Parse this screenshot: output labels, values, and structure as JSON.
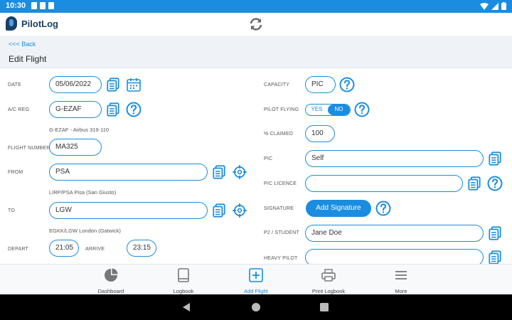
{
  "status": {
    "time": "10:30"
  },
  "app": {
    "name": "PilotLog"
  },
  "nav": {
    "back": "<<< Back",
    "title": "Edit Flight"
  },
  "form": {
    "date": {
      "label": "DATE",
      "value": "05/06/2022"
    },
    "acreg": {
      "label": "A/C REG",
      "value": "G-EZAF",
      "hint": "G-EZAF - Airbus 319-110"
    },
    "flightnumber": {
      "label": "FLIGHT NUMBER",
      "value": "MA325"
    },
    "from": {
      "label": "FROM",
      "value": "PSA",
      "hint": "LIRP/PSA Pisa (San Giusto)"
    },
    "to": {
      "label": "TO",
      "value": "LGW",
      "hint": "EGKK/LGW London (Gatwick)"
    },
    "depart": {
      "label": "DEPART",
      "value": "21:05"
    },
    "arrive": {
      "label": "ARRIVE",
      "value": "23:15"
    },
    "capacity": {
      "label": "CAPACITY",
      "value": "PIC"
    },
    "pilotflying": {
      "label": "PILOT FLYING",
      "yes": "YES",
      "no": "NO",
      "selected": "NO"
    },
    "claimed": {
      "label": "% CLAIMED",
      "value": "100"
    },
    "pic": {
      "label": "PIC",
      "value": "Self"
    },
    "piclicence": {
      "label": "PIC LICENCE",
      "value": ""
    },
    "signature": {
      "label": "SIGNATURE",
      "button": "Add Signature"
    },
    "p2": {
      "label": "P2 / STUDENT",
      "value": "Jane Doe"
    },
    "heavy": {
      "label": "HEAVY PILOT",
      "value": ""
    }
  },
  "bottomnav": [
    {
      "label": "Dashboard",
      "icon": "pie-chart-icon"
    },
    {
      "label": "Logbook",
      "icon": "book-icon"
    },
    {
      "label": "Add Flight",
      "icon": "plus-square-icon",
      "active": true
    },
    {
      "label": "Print Logbook",
      "icon": "printer-icon"
    },
    {
      "label": "More",
      "icon": "menu-icon"
    }
  ],
  "colors": {
    "primary": "#1a8de0",
    "statusbar": "#1a8de0",
    "brand": "#1b3f66"
  }
}
